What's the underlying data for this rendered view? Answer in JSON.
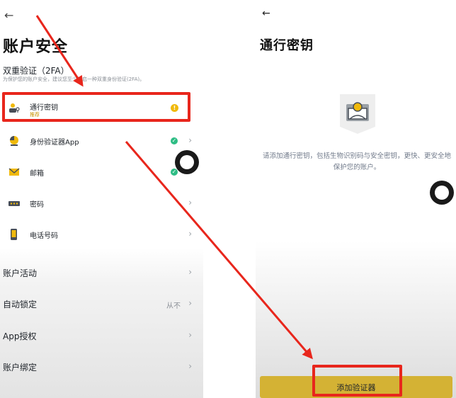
{
  "left": {
    "back_glyph": "←",
    "title": "账户安全",
    "twofa_title": "双重验证（2FA）",
    "twofa_note": "为保护您的账户安全，建议您至少开启一种双重身份验证(2FA)。",
    "methods": [
      {
        "label": "通行密钥",
        "sub": "推荐",
        "icon": "passkey-icon",
        "status": "warning"
      },
      {
        "label": "身份验证器App",
        "icon": "authenticator-app-icon",
        "status": "enabled"
      },
      {
        "label": "邮箱",
        "icon": "email-icon",
        "status": "enabled"
      },
      {
        "label": "密码",
        "icon": "password-icon",
        "status": "none"
      },
      {
        "label": "电话号码",
        "icon": "phone-icon",
        "status": "none"
      }
    ],
    "settings": [
      {
        "label": "账户活动",
        "value": ""
      },
      {
        "label": "自动锁定",
        "value": "从不"
      },
      {
        "label": "App授权",
        "value": ""
      },
      {
        "label": "账户绑定",
        "value": ""
      }
    ],
    "chevron": "›",
    "warn_glyph": "!",
    "ok_glyph": "✓"
  },
  "right": {
    "back_glyph": "←",
    "title": "通行密钥",
    "description": "请添加通行密钥，包括生物识别码与安全密钥，更快、更安全地保护您的账户。",
    "add_button": "添加验证器"
  },
  "colors": {
    "brand_yellow": "#F0B90B",
    "highlight_red": "#E8261C",
    "success_green": "#2EBD85",
    "button_gold": "#D4B234"
  }
}
